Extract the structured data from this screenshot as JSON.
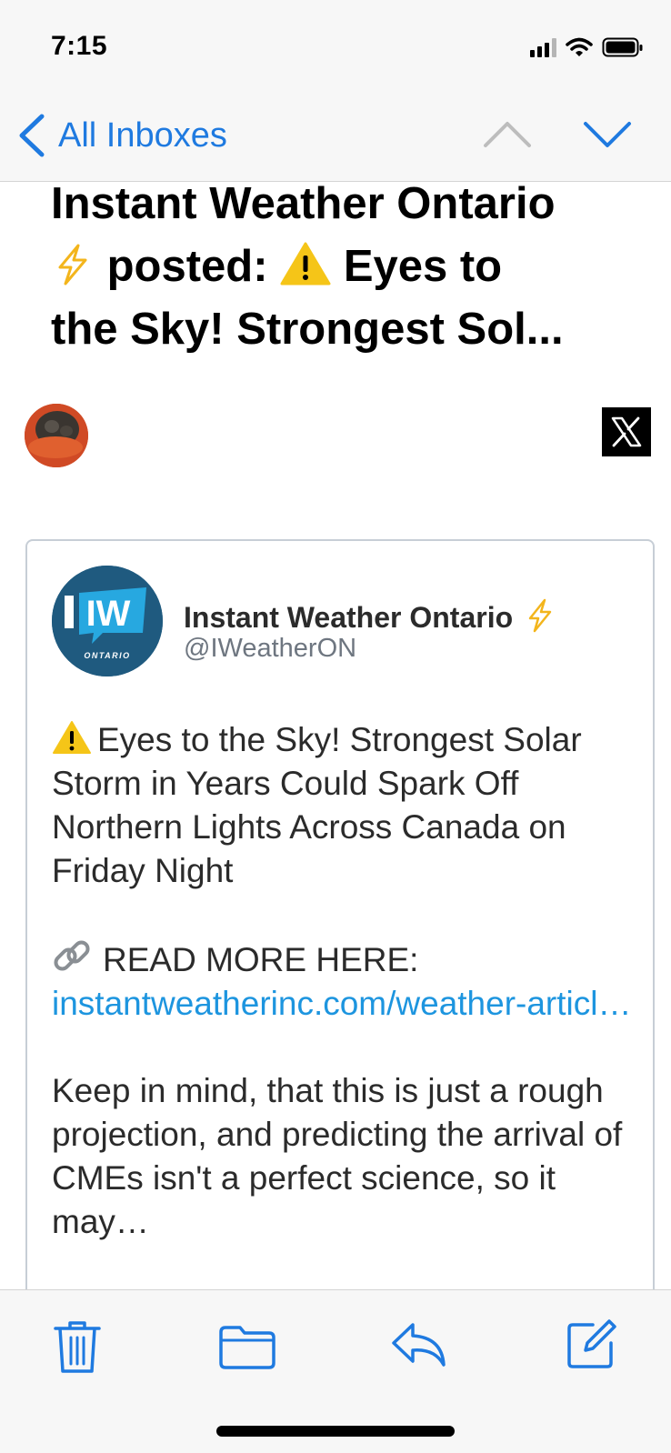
{
  "status_bar": {
    "time": "7:15"
  },
  "nav": {
    "back_label": "All Inboxes"
  },
  "subject": {
    "part1": "Instant Weather Ontario",
    "part2": "posted:",
    "part3": "Eyes to",
    "part4": "the Sky! Strongest Sol..."
  },
  "tweet": {
    "account_name": "Instant Weather Ontario",
    "handle": "@IWeatherON",
    "logo_letters": "IW",
    "logo_caption": "ONTARIO",
    "headline": "Eyes to the Sky! Strongest Solar Storm in Years Could Spark Off Northern Lights Across Canada on Friday Night",
    "read_more": "READ MORE HERE:",
    "link": "instantweatherinc.com/weather-articl…",
    "body": "Keep in mind, that this is just a rough projection, and predicting the arrival of CMEs isn't a perfect science, so it may…"
  },
  "colors": {
    "accent": "#1f7ae0",
    "link": "#1d95df",
    "logo_bg": "#1f5a7f"
  },
  "icons": [
    "chevron-left-icon",
    "chevron-up-icon",
    "chevron-down-icon",
    "lightning-icon",
    "warning-icon",
    "x-logo-icon",
    "link-icon",
    "trash-icon",
    "folder-icon",
    "reply-icon",
    "compose-icon"
  ]
}
